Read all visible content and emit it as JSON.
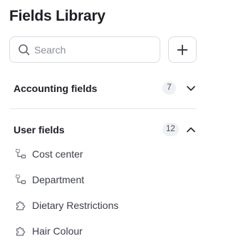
{
  "title": "Fields Library",
  "search": {
    "placeholder": "Search",
    "value": ""
  },
  "add_button": {
    "icon": "plus-icon"
  },
  "sections": [
    {
      "label": "Accounting fields",
      "count": "7",
      "expanded": false
    },
    {
      "label": "User fields",
      "count": "12",
      "expanded": true,
      "items": [
        {
          "label": "Cost center",
          "icon": "hierarchy-icon"
        },
        {
          "label": "Department",
          "icon": "hierarchy-icon"
        },
        {
          "label": "Dietary Restrictions",
          "icon": "puzzle-icon"
        },
        {
          "label": "Hair Colour",
          "icon": "puzzle-icon"
        }
      ]
    }
  ]
}
